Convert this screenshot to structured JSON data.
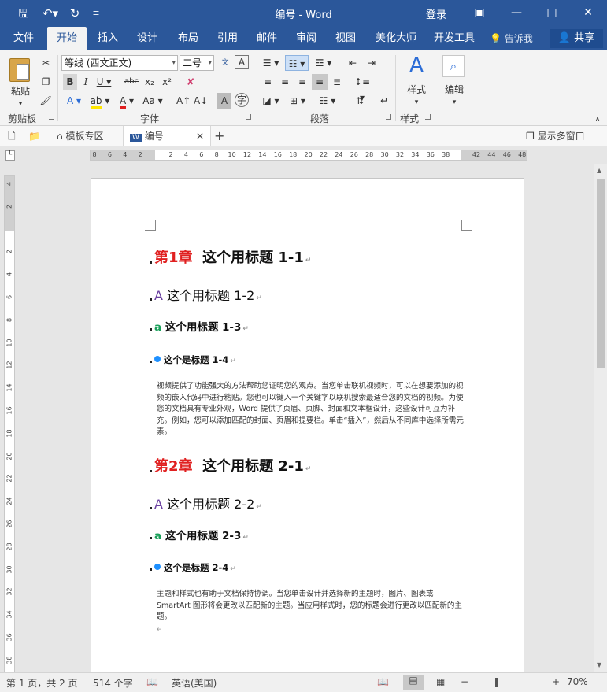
{
  "window": {
    "title": "编号 - Word",
    "login": "登录",
    "share": "共享",
    "tell_me": "告诉我"
  },
  "tabs": [
    "文件",
    "开始",
    "插入",
    "设计",
    "布局",
    "引用",
    "邮件",
    "审阅",
    "视图",
    "美化大师",
    "开发工具"
  ],
  "active_tab": "开始",
  "ribbon": {
    "clipboard": {
      "label": "剪贴板",
      "paste": "粘贴"
    },
    "font": {
      "label": "字体",
      "font_name": "等线 (西文正文)",
      "font_size": "二号"
    },
    "paragraph": {
      "label": "段落"
    },
    "styles": {
      "label": "样式",
      "button": "样式"
    },
    "editing": {
      "button": "编辑"
    }
  },
  "doc_tabs": {
    "template": "模板专区",
    "current": "编号",
    "multi_window": "显示多窗口"
  },
  "ruler": {
    "h_ticks": [
      "8",
      "6",
      "4",
      "2",
      "",
      "2",
      "4",
      "6",
      "8",
      "10",
      "12",
      "14",
      "16",
      "18",
      "20",
      "22",
      "24",
      "26",
      "28",
      "30",
      "32",
      "34",
      "36",
      "38",
      "",
      "42",
      "44",
      "46",
      "48"
    ],
    "v_ticks": [
      "4",
      "2",
      "",
      "2",
      "4",
      "6",
      "8",
      "10",
      "12",
      "14",
      "16",
      "18",
      "20",
      "22",
      "24",
      "26",
      "28",
      "30",
      "32",
      "34",
      "36",
      "38"
    ]
  },
  "document": {
    "s1": {
      "h1_num": "第1章",
      "h1_text": "这个用标题 1-1",
      "h2_letter": "A",
      "h2_text": "这个用标题 1-2",
      "h3_letter": "a",
      "h3_text": "这个用标题 1-3",
      "h4_text": "这个是标题 1-4",
      "para": "视频提供了功能强大的方法帮助您证明您的观点。当您单击联机视频时，可以在想要添加的视频的嵌入代码中进行粘贴。您也可以键入一个关键字以联机搜索最适合您的文档的视频。为使您的文档具有专业外观，Word 提供了页眉、页脚、封面和文本框设计，这些设计可互为补充。例如，您可以添加匹配的封面、页眉和提要栏。单击“插入”，然后从不同库中选择所需元素。"
    },
    "s2": {
      "h1_num": "第2章",
      "h1_text": "这个用标题 2-1",
      "h2_letter": "A",
      "h2_text": "这个用标题 2-2",
      "h3_letter": "a",
      "h3_text": "这个用标题 2-3",
      "h4_text": "这个是标题 2-4",
      "para": "主题和样式也有助于文档保持协调。当您单击设计并选择新的主题时，图片、图表或 SmartArt 图形将会更改以匹配新的主题。当应用样式时，您的标题会进行更改以匹配新的主题。"
    },
    "return_mark": "↵"
  },
  "status": {
    "page": "第 1 页，共 2 页",
    "words": "514 个字",
    "language": "英语(美国)",
    "zoom": "70%"
  }
}
